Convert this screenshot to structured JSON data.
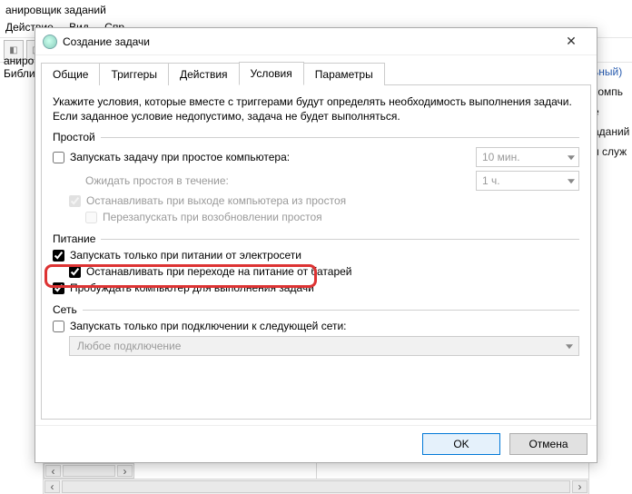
{
  "host": {
    "title_fragment": "анировщик заданий",
    "menu": {
      "action": "Действие",
      "view": "Вид",
      "help_fragment": "Спр"
    },
    "left": {
      "line1_fragment": "аниро",
      "line2_fragment": "Библи"
    },
    "right": {
      "item_enabled": "ьный)",
      "item_comp": "компь",
      "item_e": "е",
      "item_tasks": "аданий",
      "item_serv": "и служ"
    }
  },
  "dialog": {
    "title": "Создание задачи",
    "close_icon": "✕",
    "tabs": {
      "general": "Общие",
      "triggers": "Триггеры",
      "actions": "Действия",
      "conditions": "Условия",
      "settings": "Параметры"
    },
    "intro": "Укажите условия, которые вместе с триггерами будут определять необходимость выполнения задачи. Если заданное условие недопустимо, задача не будет выполняться.",
    "groups": {
      "idle": {
        "label": "Простой",
        "start_on_idle": "Запускать задачу при простое компьютера:",
        "idle_duration": "10 мин.",
        "wait_label": "Ожидать простоя в течение:",
        "wait_value": "1 ч.",
        "stop_on_exit_idle": "Останавливать при выходе компьютера из простоя",
        "restart_on_idle": "Перезапускать при возобновлении простоя"
      },
      "power": {
        "label": "Питание",
        "ac_only": "Запускать только при питании от электросети",
        "stop_on_battery": "Останавливать при переходе на питание от батарей",
        "wake": "Пробуждать компьютер для выполнения задачи"
      },
      "network": {
        "label": "Сеть",
        "only_if_network": "Запускать только при подключении к следующей сети:",
        "network_value": "Любое подключение"
      }
    },
    "buttons": {
      "ok": "OK",
      "cancel": "Отмена"
    }
  }
}
